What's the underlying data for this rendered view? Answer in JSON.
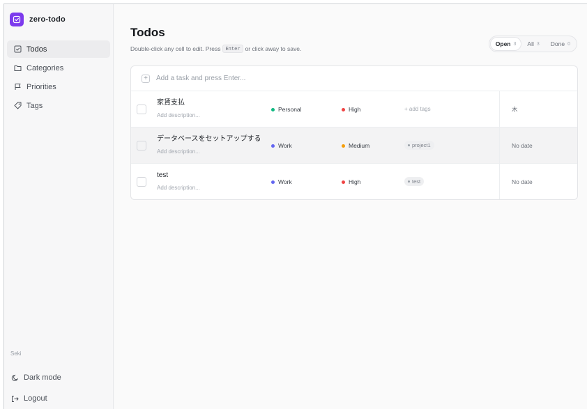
{
  "app": {
    "name": "zero-todo"
  },
  "nav": [
    {
      "key": "todos",
      "label": "Todos",
      "active": true
    },
    {
      "key": "categories",
      "label": "Categories"
    },
    {
      "key": "priorities",
      "label": "Priorities"
    },
    {
      "key": "tags",
      "label": "Tags"
    }
  ],
  "user": {
    "name": "Seki"
  },
  "bottom": {
    "dark_mode": "Dark mode",
    "logout": "Logout"
  },
  "header": {
    "title": "Todos",
    "hint_before": "Double-click any cell to edit. Press",
    "hint_key": "Enter",
    "hint_after": "or click away to save."
  },
  "filters": [
    {
      "label": "Open",
      "count": "3",
      "active": true
    },
    {
      "label": "All",
      "count": "3"
    },
    {
      "label": "Done",
      "count": "0"
    }
  ],
  "add_task": {
    "placeholder": "Add a task and press Enter..."
  },
  "todos": [
    {
      "title": "家賃支払",
      "description": "Add description...",
      "category": "Personal",
      "category_color": "#10b981",
      "priority": "High",
      "priority_color": "#ef4444",
      "tags_placeholder": "+ add tags",
      "due": "木"
    },
    {
      "title": "データベースをセットアップする",
      "description": "Add description...",
      "category": "Work",
      "category_color": "#6366f1",
      "priority": "Medium",
      "priority_color": "#f59e0b",
      "tag": "project1",
      "due": "No date"
    },
    {
      "title": "test",
      "description": "Add description...",
      "category": "Work",
      "category_color": "#6366f1",
      "priority": "High",
      "priority_color": "#ef4444",
      "tag": "test",
      "due": "No date"
    }
  ],
  "colors": {
    "brand": "#7c3aed"
  }
}
